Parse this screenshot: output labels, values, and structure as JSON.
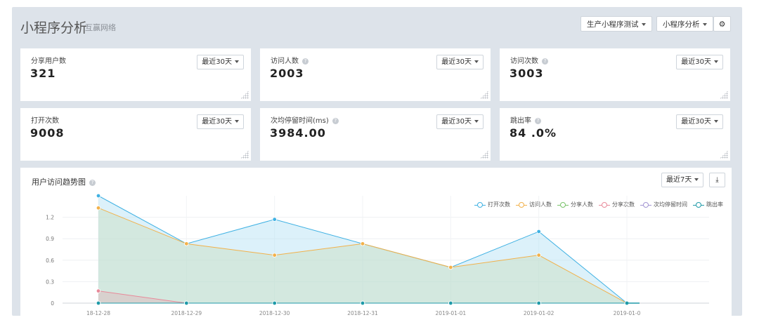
{
  "header": {
    "title": "小程序分析",
    "subtitle": "互赢网络",
    "app_select": "生产小程序测试",
    "view_select": "小程序分析",
    "settings_icon": "gear-icon"
  },
  "cards": [
    {
      "label": "分享用户数",
      "value": "321",
      "range": "最近30天",
      "help": false
    },
    {
      "label": "访问人数",
      "value": "2003",
      "range": "最近30天",
      "help": true
    },
    {
      "label": "访问次数",
      "value": "3003",
      "range": "最近30天",
      "help": true
    },
    {
      "label": "打开次数",
      "value": "9008",
      "range": "最近30天",
      "help": false
    },
    {
      "label": "次均停留时间(ms)",
      "value": "3984.00",
      "range": "最近30天",
      "help": true
    },
    {
      "label": "跳出率",
      "value": "84 .0%",
      "range": "最近30天",
      "help": true
    }
  ],
  "trend": {
    "title": "用户访问趋势图",
    "range": "最近7天",
    "download_icon": "download-icon"
  },
  "colors": {
    "open": "#3fb1e3",
    "visitors": "#f2b14a",
    "share_users": "#79c36a",
    "shares": "#e88a9a",
    "stay": "#a395d3",
    "bounce": "#1f9aa8"
  },
  "chart_data": {
    "type": "area",
    "x": [
      "18-12-28",
      "2018-12-29",
      "2018-12-30",
      "2018-12-31",
      "2019-01-01",
      "2019-01-02",
      "2019-01-0"
    ],
    "ylim": [
      0,
      1.5
    ],
    "yticks": [
      "0",
      "0.3",
      "0.6",
      "0.9",
      "1.2"
    ],
    "grid": true,
    "legend_position": "top-right",
    "series": [
      {
        "name": "打开次数",
        "color_key": "open",
        "values": [
          1.5,
          0.83,
          1.17,
          0.83,
          0.5,
          1.0,
          0
        ]
      },
      {
        "name": "访问人数",
        "color_key": "visitors",
        "values": [
          1.33,
          0.83,
          0.67,
          0.83,
          0.5,
          0.67,
          0
        ]
      },
      {
        "name": "分享人数",
        "color_key": "share_users",
        "values": [
          0,
          0,
          0,
          0,
          0,
          0,
          0
        ]
      },
      {
        "name": "分享次数",
        "color_key": "shares",
        "values": [
          0.17,
          0,
          0,
          0,
          0,
          0,
          0
        ]
      },
      {
        "name": "次均停留时间",
        "color_key": "stay",
        "values": [
          0,
          0,
          0,
          0,
          0,
          0,
          0
        ]
      },
      {
        "name": "跳出率",
        "color_key": "bounce",
        "values": [
          0,
          0,
          0,
          0,
          0,
          0,
          0
        ]
      }
    ]
  }
}
